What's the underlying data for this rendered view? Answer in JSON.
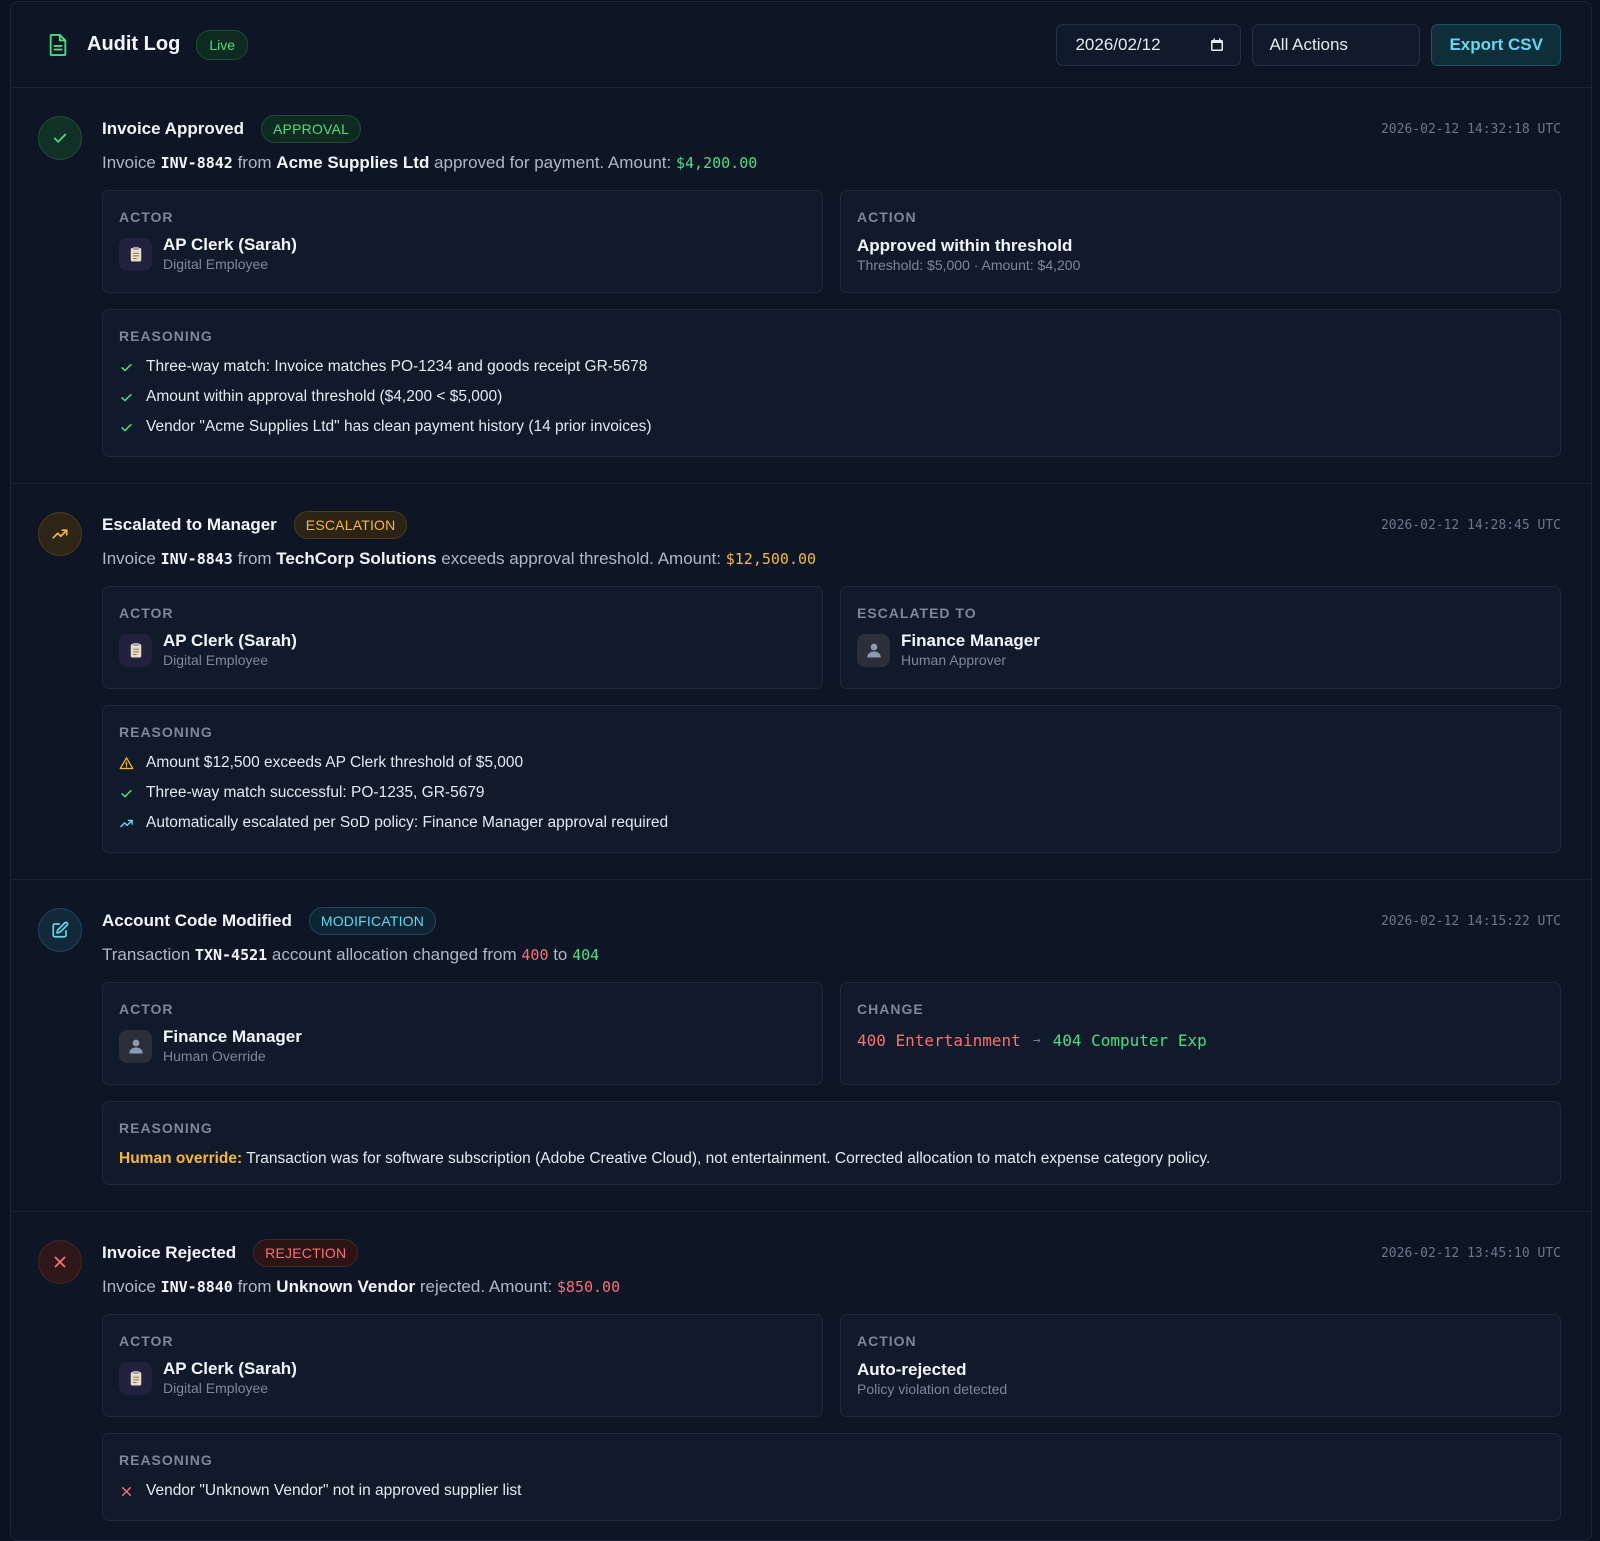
{
  "header": {
    "title": "Audit Log",
    "live_label": "Live",
    "date_value": "2026/02/12",
    "action_filter": "All Actions",
    "export_label": "Export CSV"
  },
  "colors": {
    "approval": "#4ade80",
    "escalation": "#f5b73c",
    "modification": "#67d6f0",
    "rejection": "#f87171"
  },
  "entries": [
    {
      "title": "Invoice Approved",
      "badge": "APPROVAL",
      "timestamp": "2026-02-12 14:32:18 UTC",
      "desc": {
        "p1": "Invoice ",
        "code": "INV-8842",
        "p2": " from ",
        "vendor": "Acme Supplies Ltd",
        "p3": " approved for payment. Amount: ",
        "amount": "$4,200.00"
      },
      "left": {
        "label": "ACTOR",
        "name": "AP Clerk (Sarah)",
        "sub": "Digital Employee"
      },
      "right": {
        "label": "ACTION",
        "title": "Approved within threshold",
        "sub": "Threshold: $5,000 · Amount: $4,200"
      },
      "reasoning_label": "REASONING",
      "reasons": [
        "Three-way match: Invoice matches PO-1234 and goods receipt GR-5678",
        "Amount within approval threshold ($4,200 < $5,000)",
        "Vendor \"Acme Supplies Ltd\" has clean payment history (14 prior invoices)"
      ]
    },
    {
      "title": "Escalated to Manager",
      "badge": "ESCALATION",
      "timestamp": "2026-02-12 14:28:45 UTC",
      "desc": {
        "p1": "Invoice ",
        "code": "INV-8843",
        "p2": " from ",
        "vendor": "TechCorp Solutions",
        "p3": " exceeds approval threshold. Amount: ",
        "amount": "$12,500.00"
      },
      "left": {
        "label": "ACTOR",
        "name": "AP Clerk (Sarah)",
        "sub": "Digital Employee"
      },
      "right": {
        "label": "ESCALATED TO",
        "name": "Finance Manager",
        "sub": "Human Approver"
      },
      "reasoning_label": "REASONING",
      "reasons": [
        "Amount $12,500 exceeds AP Clerk threshold of $5,000",
        "Three-way match successful: PO-1235, GR-5679",
        "Automatically escalated per SoD policy: Finance Manager approval required"
      ]
    },
    {
      "title": "Account Code Modified",
      "badge": "MODIFICATION",
      "timestamp": "2026-02-12 14:15:22 UTC",
      "desc": {
        "p1": "Transaction ",
        "code": "TXN-4521",
        "p2": " account allocation changed from ",
        "from": "400",
        "p3": " to ",
        "to": "404"
      },
      "left": {
        "label": "ACTOR",
        "name": "Finance Manager",
        "sub": "Human Override"
      },
      "right": {
        "label": "CHANGE",
        "from": "400 Entertainment",
        "arrow": "→",
        "to": "404 Computer Exp"
      },
      "reasoning_label": "REASONING",
      "reason_highlight": "Human override:",
      "reason_text": " Transaction was for software subscription (Adobe Creative Cloud), not entertainment. Corrected allocation to match expense category policy."
    },
    {
      "title": "Invoice Rejected",
      "badge": "REJECTION",
      "timestamp": "2026-02-12 13:45:10 UTC",
      "desc": {
        "p1": "Invoice ",
        "code": "INV-8840",
        "p2": " from ",
        "vendor": "Unknown Vendor",
        "p3": " rejected. Amount: ",
        "amount": "$850.00"
      },
      "left": {
        "label": "ACTOR",
        "name": "AP Clerk (Sarah)",
        "sub": "Digital Employee"
      },
      "right": {
        "label": "ACTION",
        "title": "Auto-rejected",
        "sub": "Policy violation detected"
      },
      "reasoning_label": "REASONING",
      "reasons": [
        "Vendor \"Unknown Vendor\" not in approved supplier list"
      ]
    }
  ]
}
